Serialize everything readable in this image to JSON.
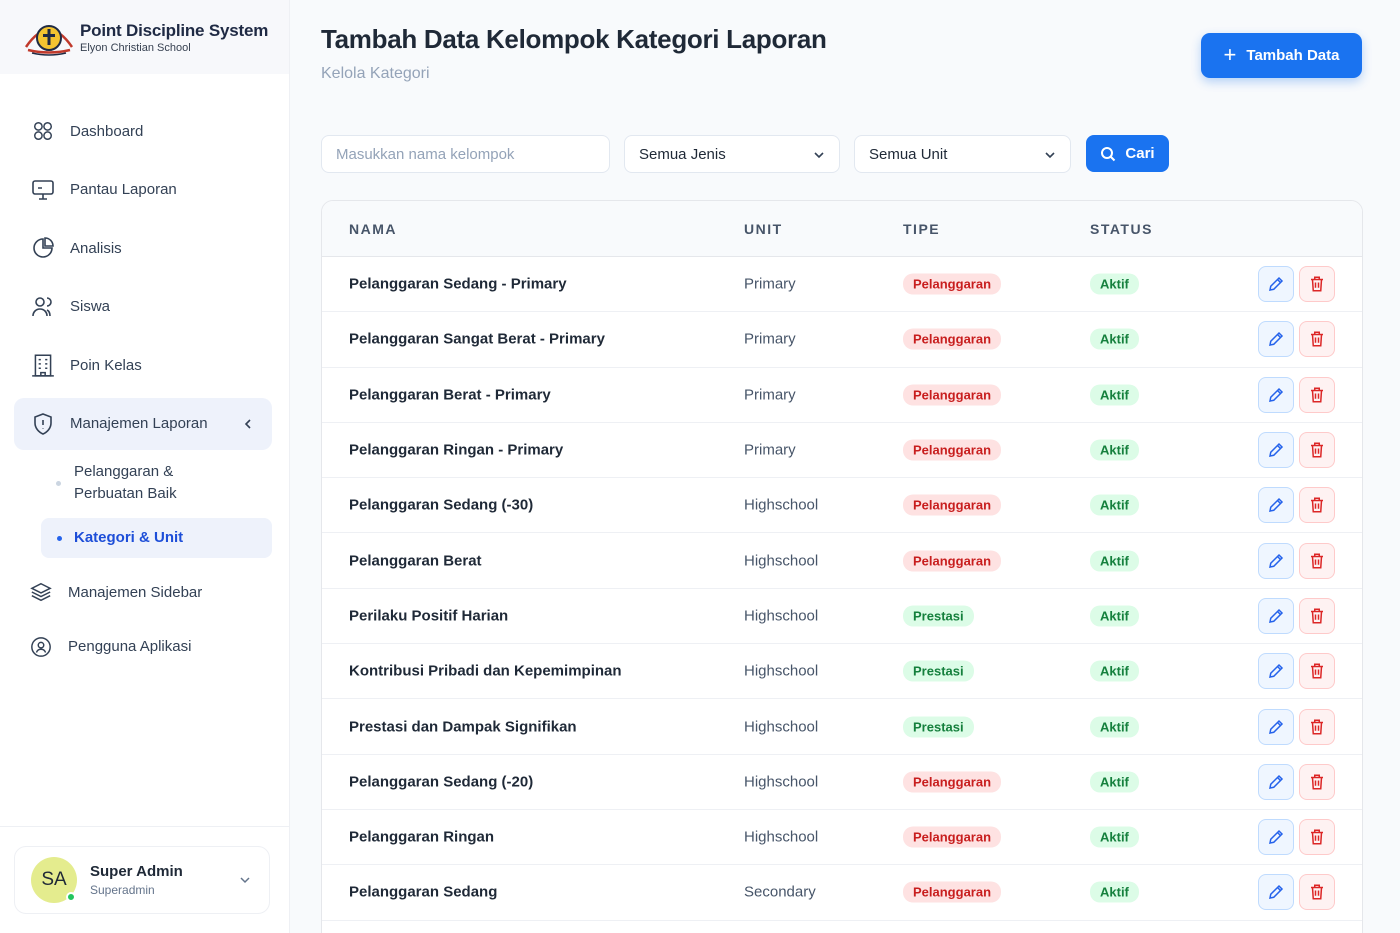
{
  "brand": {
    "title": "Point Discipline System",
    "subtitle": "Elyon Christian School"
  },
  "nav": [
    {
      "label": "Dashboard",
      "icon": "dashboard-icon"
    },
    {
      "label": "Pantau Laporan",
      "icon": "monitor-icon"
    },
    {
      "label": "Analisis",
      "icon": "pie-chart-icon"
    },
    {
      "label": "Siswa",
      "icon": "users-icon"
    },
    {
      "label": "Poin Kelas",
      "icon": "building-icon"
    },
    {
      "label": "Manajemen Laporan",
      "icon": "shield-alert-icon",
      "active": true
    }
  ],
  "subnav": [
    {
      "label": "Pelanggaran & Perbuatan Baik"
    },
    {
      "label": "Kategori & Unit",
      "selected": true
    }
  ],
  "nav_bottom": [
    {
      "label": "Manajemen Sidebar",
      "icon": "layers-icon"
    },
    {
      "label": "Pengguna Aplikasi",
      "icon": "user-badge-icon"
    }
  ],
  "user": {
    "initials": "SA",
    "name": "Super Admin",
    "role": "Superadmin"
  },
  "header": {
    "title": "Tambah Data Kelompok Kategori Laporan",
    "subtitle": "Kelola Kategori",
    "add_label": "Tambah Data"
  },
  "filters": {
    "search_placeholder": "Masukkan nama kelompok",
    "jenis_value": "Semua Jenis",
    "unit_value": "Semua Unit",
    "cari_label": "Cari"
  },
  "colors": {
    "primary": "#1a73f0",
    "danger": "#c81e1e",
    "success": "#15803d"
  },
  "table": {
    "columns": [
      "NAMA",
      "UNIT",
      "TIPE",
      "STATUS"
    ],
    "rows": [
      {
        "nama": "Pelanggaran Sedang - Primary",
        "unit": "Primary",
        "tipe": "Pelanggaran",
        "status": "Aktif"
      },
      {
        "nama": "Pelanggaran Sangat Berat - Primary",
        "unit": "Primary",
        "tipe": "Pelanggaran",
        "status": "Aktif"
      },
      {
        "nama": "Pelanggaran Berat - Primary",
        "unit": "Primary",
        "tipe": "Pelanggaran",
        "status": "Aktif"
      },
      {
        "nama": "Pelanggaran Ringan - Primary",
        "unit": "Primary",
        "tipe": "Pelanggaran",
        "status": "Aktif"
      },
      {
        "nama": "Pelanggaran Sedang (-30)",
        "unit": "Highschool",
        "tipe": "Pelanggaran",
        "status": "Aktif"
      },
      {
        "nama": "Pelanggaran Berat",
        "unit": "Highschool",
        "tipe": "Pelanggaran",
        "status": "Aktif"
      },
      {
        "nama": "Perilaku Positif Harian",
        "unit": "Highschool",
        "tipe": "Prestasi",
        "status": "Aktif"
      },
      {
        "nama": "Kontribusi Pribadi dan Kepemimpinan",
        "unit": "Highschool",
        "tipe": "Prestasi",
        "status": "Aktif"
      },
      {
        "nama": "Prestasi dan Dampak Signifikan",
        "unit": "Highschool",
        "tipe": "Prestasi",
        "status": "Aktif"
      },
      {
        "nama": "Pelanggaran Sedang (-20)",
        "unit": "Highschool",
        "tipe": "Pelanggaran",
        "status": "Aktif"
      },
      {
        "nama": "Pelanggaran Ringan",
        "unit": "Highschool",
        "tipe": "Pelanggaran",
        "status": "Aktif"
      },
      {
        "nama": "Pelanggaran Sedang",
        "unit": "Secondary",
        "tipe": "Pelanggaran",
        "status": "Aktif"
      }
    ]
  }
}
